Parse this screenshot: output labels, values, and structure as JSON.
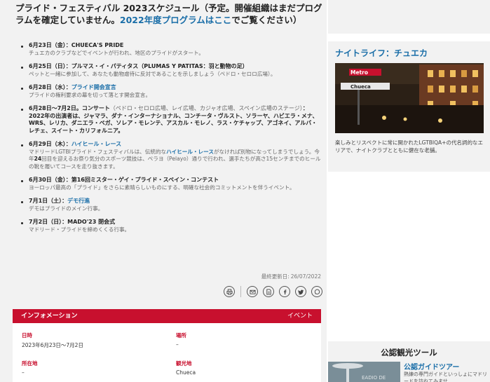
{
  "title": {
    "part1": "プライド・フェスティバル 2023スケジュール（予定。開催組織はまだプログラムを確定していません。",
    "link": "2022年度プログラムはここ",
    "part2": "でご覧ください）"
  },
  "events": [
    {
      "date": "6月23日（金）：",
      "name": "CHUECA'S PRIDE",
      "desc": "チュエカのクラブなどでイベントが行われ、地区のプライドがスタート。"
    },
    {
      "date": "6月25日（日）：",
      "name": "プルマス・イ・パティタス（PLUMAS Y PATITAS：羽と動物の足）",
      "desc": "ペットと一緒に参加して、あなたも動物虐待に反対であることを示しましょう（ペドロ・セロロ広場）。"
    },
    {
      "date": "6月28日（水）：",
      "link": "プライド開会宣言",
      "desc": "プライドの権利要求の幕を切って落とす開会宣言。"
    },
    {
      "date": "6月28日～7月2日。コンサート",
      "extra": "（ペドロ・セロロ広場、レイ広場、カジャオ広場、スペイン広場のステージ）",
      "desc_bold": "：2022年の出演者は、ジャマラ、ダナ・インターナショナル、コンチータ・ヴルスト、ソラーヤ、ハビエラ・メナ、WRS、レリカ、ダニエラ・ベガ、ソレア・モレンテ、アスカル・モレノ、ラス・ケチャップ、アゴネイ、アルバ・レチェ、スイート・カリフォルニア。"
    },
    {
      "date": "6月29日（木）：",
      "link": "ハイヒール・レース",
      "desc_pre": "マドリードLGTBIプライド・フェスティバルは、伝統的な",
      "desc_link": "ハイヒール・レース",
      "desc_mid": "がなければ別物になってしまうでしょう。今年",
      "desc_bold2": "24",
      "desc_post": "回目を迎えるお祭り気分のスポーツ競技は、ペラヨ（Pelayo）通りで行われ、選手たちが高さ15センチまでのヒールの靴を履いてコースを走り抜きます。"
    },
    {
      "date": "6月30日（金）：",
      "name": "第16回ミスター・ゲイ・プライド・スペイン・コンテスト",
      "desc": "ヨーロッパ最高の「プライド」をさらに素晴らしいものにする、明確な社会的コミットメントを伴うイベント。"
    },
    {
      "date": "7月1日（土）：",
      "link": "デモ行進",
      "desc": "デモはプライドのメイン行事。"
    },
    {
      "date": "7月2日（日）：",
      "name": "MADO'23 閉会式",
      "desc": "マドリード・プライドを締めくくる行事。"
    }
  ],
  "updated": {
    "label": "最終更新日:",
    "value": "26/07/2022"
  },
  "share_icons": [
    "print-icon",
    "email-icon",
    "pdf-icon",
    "facebook-icon",
    "twitter-icon",
    "whatsapp-icon"
  ],
  "info": {
    "header": "インフォメーション",
    "tag": "イベント",
    "fields": {
      "date_label": "日時",
      "date_value": "2023年6月23日～7月2日",
      "place_label": "場所",
      "place_value": "–",
      "address_label": "所在地",
      "address_value": "–",
      "area_label": "観光地",
      "area_value": "Chueca"
    }
  },
  "sidebar": {
    "panel_title": "ナイトライフ：チュエカ",
    "metro_label": "Metro",
    "station_label": "Chueca",
    "panel_desc": "楽しみとリスペクトに常に開かれたLGTBIQA+の代名詞的なエリアで、ナイトクラブとともに健在な老舗。",
    "tools_title": "公認観光ツール",
    "guide_title": "公認ガイドツアー",
    "guide_desc": "熱練の専門ガイドといっしょにマドリードを訪ねてみませ",
    "thumb_text": "EADIO DE"
  },
  "colors": {
    "accent_red": "#c8102e",
    "link_blue": "#1a6ea8"
  }
}
